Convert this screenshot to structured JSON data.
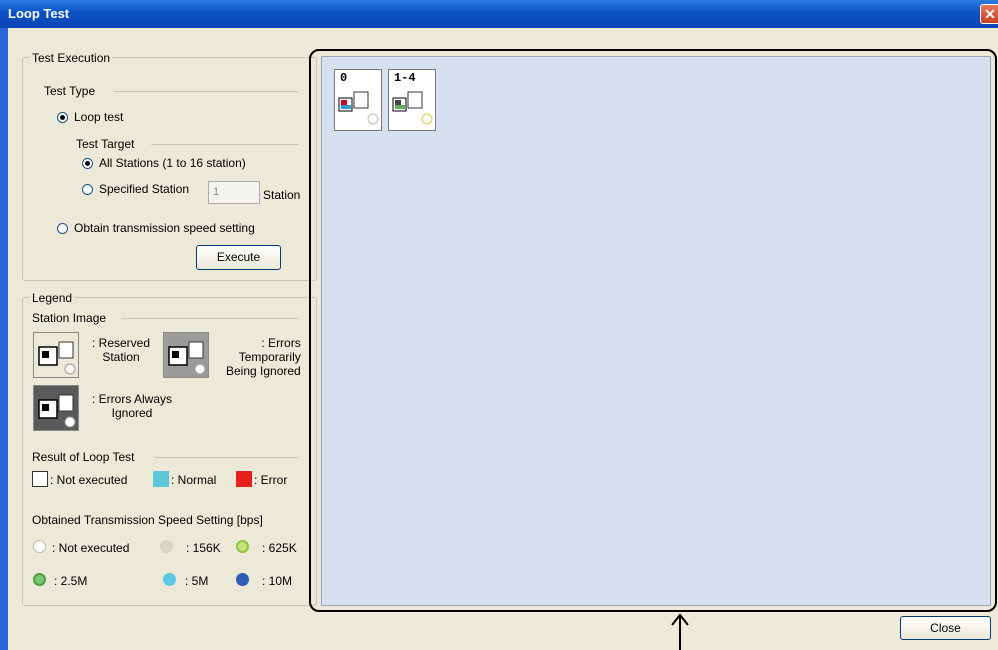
{
  "window": {
    "title": "Loop Test",
    "close_glyph": "✕"
  },
  "test_execution": {
    "title": "Test Execution",
    "test_type_label": "Test Type",
    "loop_test_label": "Loop test",
    "test_target_label": "Test Target",
    "all_stations_label": "All Stations (1 to 16 station)",
    "specified_station_label": "Specified Station",
    "station_value": "1",
    "station_suffix": "Station",
    "obtain_speed_label": "Obtain transmission speed setting",
    "execute_label": "Execute",
    "selected_type": "Loop test",
    "selected_target": "All Stations (1 to 16 station)"
  },
  "legend": {
    "title": "Legend",
    "station_image_label": "Station Image",
    "reserved_label": ": Reserved\nStation",
    "errors_temp_label": ": Errors\nTemporarily\nBeing Ignored",
    "errors_always_label": ": Errors Always\nIgnored",
    "result_label": "Result of Loop Test",
    "not_executed_label": ": Not executed",
    "normal_label": ": Normal",
    "error_label": ": Error",
    "speed_title": "Obtained Transmission Speed Setting [bps]",
    "speed_not_executed": ": Not executed",
    "speed_156k": ": 156K",
    "speed_625k": ": 625K",
    "speed_2_5m": ": 2.5M",
    "speed_5m": ": 5M",
    "speed_10m": ": 10M",
    "colors": {
      "normal": "#5bc8d8",
      "error": "#e8201c",
      "not_executed": "#ffffff"
    }
  },
  "stations": [
    {
      "label": "0"
    },
    {
      "label": "1-4"
    }
  ],
  "footer": {
    "close_label": "Close"
  }
}
